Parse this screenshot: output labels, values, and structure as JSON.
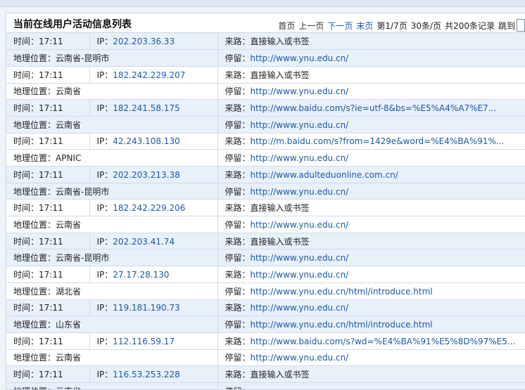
{
  "panel": {
    "title": "当前在线用户活动信息列表"
  },
  "pager": {
    "first": "首页",
    "prev": "上一页",
    "next": "下一页",
    "last": "末页",
    "page_info": "第1/7页",
    "per_page": "30条/页",
    "total": "共200条记录",
    "jump": "跳到"
  },
  "labels": {
    "time": "时间：",
    "ip": "IP：",
    "referrer": "来路：",
    "location": "地理位置：",
    "stay": "停留："
  },
  "records": [
    {
      "time": "17:11",
      "ip": "202.203.36.33",
      "referrer": "直接输入或书签",
      "location": "云南省-昆明市",
      "stay": "http://www.ynu.edu.cn/"
    },
    {
      "time": "17:11",
      "ip": "182.242.229.207",
      "referrer": "直接输入或书签",
      "location": "云南省",
      "stay": "http://www.ynu.edu.cn/"
    },
    {
      "time": "17:11",
      "ip": "182.241.58.175",
      "referrer": "http://www.baidu.com/s?ie=utf-8&bs=%E5%A4%A7%E7...",
      "location": "云南省",
      "stay": "http://www.ynu.edu.cn/"
    },
    {
      "time": "17:11",
      "ip": "42.243.108.130",
      "referrer": "http://m.baidu.com/s?from=1429e&word=%E4%BA%91%...",
      "location": "APNIC",
      "stay": "http://www.ynu.edu.cn/"
    },
    {
      "time": "17:11",
      "ip": "202.203.213.38",
      "referrer": "http://www.adulteduonline.com.cn/",
      "location": "云南省-昆明市",
      "stay": "http://www.ynu.edu.cn/"
    },
    {
      "time": "17:11",
      "ip": "182.242.229.206",
      "referrer": "直接输入或书签",
      "location": "云南省",
      "stay": "http://www.ynu.edu.cn/"
    },
    {
      "time": "17:11",
      "ip": "202.203.41.74",
      "referrer": "直接输入或书签",
      "location": "云南省-昆明市",
      "stay": "http://www.ynu.edu.cn/"
    },
    {
      "time": "17:11",
      "ip": "27.17.28.130",
      "referrer": "http://www.ynu.edu.cn/",
      "location": "湖北省",
      "stay": "http://www.ynu.edu.cn/html/introduce.html"
    },
    {
      "time": "17:11",
      "ip": "119.181.190.73",
      "referrer": "http://www.ynu.edu.cn/",
      "location": "山东省",
      "stay": "http://www.ynu.edu.cn/html/introduce.html"
    },
    {
      "time": "17:11",
      "ip": "112.116.59.17",
      "referrer": "http://www.baidu.com/s?wd=%E4%BA%91%E5%8D%97%E5...",
      "location": "云南省",
      "stay": "http://www.ynu.edu.cn/"
    },
    {
      "time": "17:11",
      "ip": "116.53.253.228",
      "referrer": "直接输入或书签",
      "location": "云南省",
      "stay": ""
    }
  ]
}
